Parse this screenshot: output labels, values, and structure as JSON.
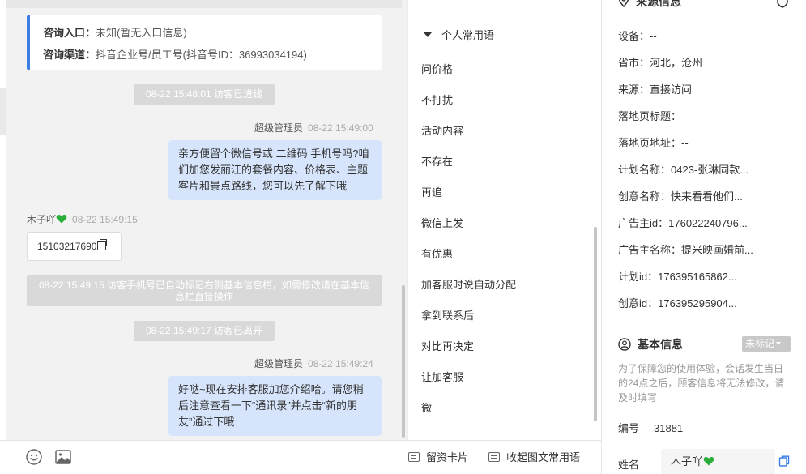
{
  "entry": {
    "entrance_label": "咨询入口：",
    "entrance_value": "未知(暂无入口信息)",
    "channel_label": "咨询渠道：",
    "channel_value": "抖音企业号/员工号(抖音号ID：36993034194)"
  },
  "messages": {
    "sys_enter": "08-22 15:48:01 访客已进线",
    "agent_name_1": "超级管理员",
    "agent_time_1": "08-22 15:49:00",
    "agent_msg_1": "亲方便留个微信号或 二维码 手机号吗?咱们加您发丽江的套餐内容、价格表、主题客片和景点路线，您可以先了解下哦",
    "visitor_name": "木子吖",
    "visitor_time": "08-22 15:49:15",
    "visitor_phone": "15103217690",
    "sys_phone": "08-22 15:49:15 访客手机号已自动标记右侧基本信息栏，如需修改请在基本信息栏直接操作",
    "sys_leave": "08-22 15:49:17 访客已离开",
    "agent_name_2": "超级管理员",
    "agent_time_2": "08-22 15:49:24",
    "agent_msg_2": "好哒~现在安排客服加您介绍哈。请您稍后注意查看一下“通讯录”并点击“新的朋友”通过下哦"
  },
  "toolbar": {
    "emoji_icon": "emoji-icon",
    "image_icon": "image-icon",
    "keep_card": "留资卡片",
    "collapse_phrases": "收起图文常用语"
  },
  "phrases": {
    "header": "个人常用语",
    "items": [
      "问价格",
      "不打扰",
      "活动内容",
      "不存在",
      "再追",
      "微信上发",
      "有优惠",
      "加客服时说自动分配",
      "拿到联系后",
      "对比再决定",
      "让加客服",
      "微"
    ]
  },
  "source": {
    "title": "来源信息",
    "rows": [
      {
        "k": "设备：",
        "v": "--"
      },
      {
        "k": "省市：",
        "v": "河北，沧州"
      },
      {
        "k": "来源：",
        "v": "直接访问"
      },
      {
        "k": "落地页标题：",
        "v": "--"
      },
      {
        "k": "落地页地址：",
        "v": "--"
      },
      {
        "k": "计划名称：",
        "v": "0423-张琳同款..."
      },
      {
        "k": "创意名称：",
        "v": "快来看看他们..."
      },
      {
        "k": "广告主id：",
        "v": "176022240796..."
      },
      {
        "k": "广告主名称：",
        "v": "提米映画婚前..."
      },
      {
        "k": "计划id：",
        "v": "176395165862..."
      },
      {
        "k": "创意id：",
        "v": "176395295904..."
      }
    ]
  },
  "basic": {
    "title": "基本信息",
    "tag": "未标记",
    "note": "为了保障您的使用体验，会话发生当日的24点之后，顾客信息将无法修改，请及时填写",
    "id_label": "编号",
    "id_value": "31881",
    "name_label": "姓名",
    "name_value": "木子吖"
  },
  "colors": {
    "accent": "#3b7ee6",
    "bubble": "#d6e5fb",
    "system": "#d9d9d9",
    "heart": "#2aae3a"
  }
}
